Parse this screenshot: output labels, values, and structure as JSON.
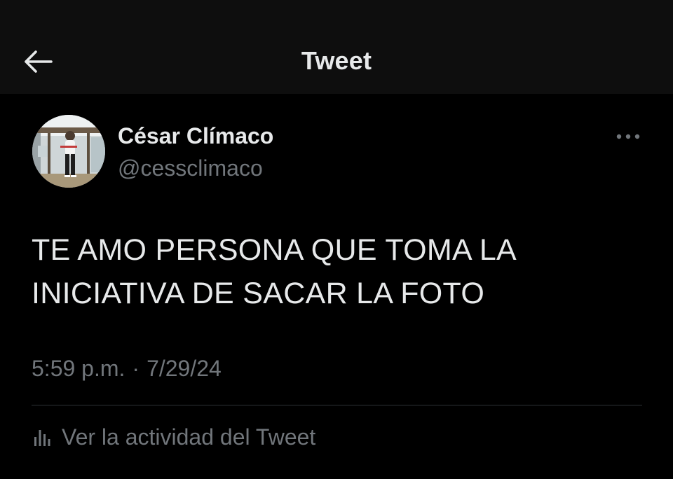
{
  "header": {
    "title": "Tweet",
    "back_icon": "arrow-left-icon"
  },
  "author": {
    "display_name": "César Clímaco",
    "handle": "@cessclimaco",
    "avatar_icon": "profile-photo"
  },
  "tweet": {
    "text": "TE AMO PERSONA QUE TOMA LA\nINICIATIVA DE SACAR LA FOTO",
    "time": "5:59 p.m.",
    "separator": "·",
    "date": "7/29/24"
  },
  "actions": {
    "more_icon": "more-horizontal-icon",
    "activity_icon": "bar-chart-icon",
    "activity_label": "Ver la actividad del Tweet"
  },
  "colors": {
    "background": "#000000",
    "header_background": "#0e0e0e",
    "primary_text": "#e7e9ea",
    "secondary_text": "#71767b",
    "divider": "#2f3336"
  }
}
